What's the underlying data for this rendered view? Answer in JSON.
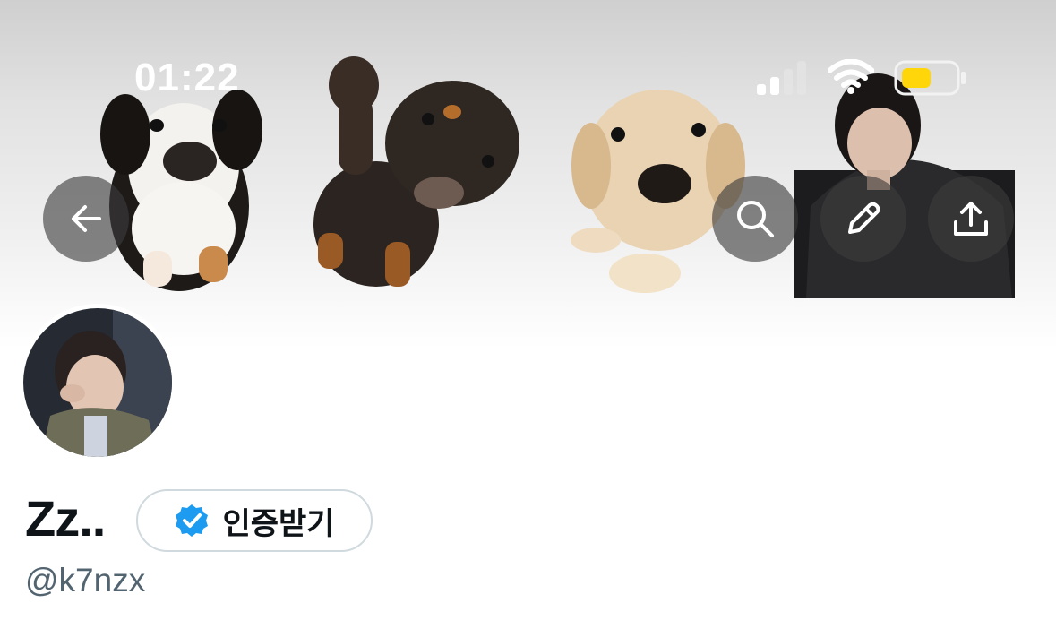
{
  "status_bar": {
    "time": "01:22",
    "battery_color": "#ffd60a"
  },
  "header": {
    "back_icon": "arrow-left-icon",
    "search_icon": "search-icon",
    "edit_icon": "pencil-icon",
    "share_icon": "share-upload-icon"
  },
  "profile": {
    "display_name": "Zz..",
    "verify_button_label": "인증받기",
    "verified_badge_color": "#1d9bf0",
    "handle": "@k7nzx"
  }
}
